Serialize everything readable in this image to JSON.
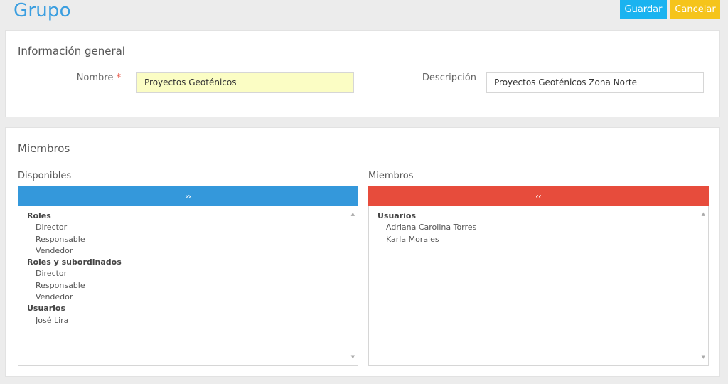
{
  "header": {
    "title": "Grupo",
    "save_label": "Guardar",
    "cancel_label": "Cancelar"
  },
  "general": {
    "section_title": "Información general",
    "name_label": "Nombre",
    "required_mark": "*",
    "name_value": "Proyectos Geoténicos",
    "description_label": "Descripción",
    "description_value": "Proyectos Geoténicos Zona Norte"
  },
  "members": {
    "section_title": "Miembros",
    "available_label": "Disponibles",
    "members_label": "Miembros",
    "add_glyph": "››",
    "remove_glyph": "‹‹",
    "available": [
      {
        "group": "Roles",
        "items": [
          "Director",
          "Responsable",
          "Vendedor"
        ]
      },
      {
        "group": "Roles y subordinados",
        "items": [
          "Director",
          "Responsable",
          "Vendedor"
        ]
      },
      {
        "group": "Usuarios",
        "items": [
          "José Lira"
        ]
      }
    ],
    "selected": [
      {
        "group": "Usuarios",
        "items": [
          "Adriana Carolina Torres",
          "Karla Morales"
        ]
      }
    ]
  },
  "colors": {
    "title": "#3a9ee0",
    "save": "#1ab3f0",
    "cancel": "#f5c41b",
    "add_bar": "#3498db",
    "remove_bar": "#e74c3c",
    "name_field_bg": "#fbfdc4"
  },
  "icons": {
    "scroll_up": "▲",
    "scroll_down": "▼"
  }
}
